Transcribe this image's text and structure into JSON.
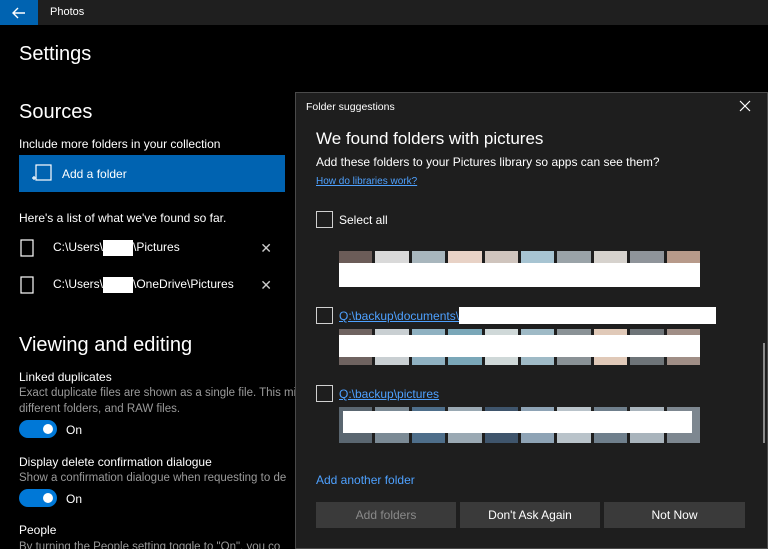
{
  "titlebar": {
    "app_title": "Photos"
  },
  "page_title": "Settings",
  "sources": {
    "heading": "Sources",
    "include_label": "Include more folders in your collection",
    "add_folder_label": "Add a folder",
    "list_label": "Here's a list of what we've found so far.",
    "folders": [
      {
        "prefix": "C:\\Users\\",
        "suffix": "\\Pictures"
      },
      {
        "prefix": "C:\\Users\\",
        "suffix": "\\OneDrive\\Pictures"
      }
    ]
  },
  "viewing": {
    "heading": "Viewing and editing",
    "linked_label": "Linked duplicates",
    "linked_desc_1": "Exact duplicate files are shown as a single file. This mi",
    "linked_desc_2": "different folders, and RAW files.",
    "linked_toggle": "On",
    "delete_label": "Display delete confirmation dialogue",
    "delete_desc": "Show a confirmation dialogue when requesting to de",
    "delete_toggle": "On",
    "people_label": "People",
    "people_desc": "By turning the People setting toggle to \"On\", you co"
  },
  "dialog": {
    "title": "Folder suggestions",
    "heading": "We found folders with pictures",
    "subtitle": "Add these folders to your Pictures library so apps can see them?",
    "help_link": "How do libraries work?",
    "select_all": "Select all",
    "folder_1": "Q:\\backup\\documents\\",
    "folder_2": "Q:\\backup\\pictures",
    "add_another": "Add another folder",
    "btn_add": "Add folders",
    "btn_dont_ask": "Don't Ask Again",
    "btn_not_now": "Not Now"
  },
  "colors": {
    "accent": "#0063b1",
    "link": "#4ea1ff",
    "toggle_on": "#0078d7"
  },
  "thumb_rows": [
    [
      "#6b5c58",
      "#d9d9d9",
      "#a8b6bd",
      "#e8d2c6",
      "#cfc4bd",
      "#a7c4d2",
      "#9aa3a8",
      "#d6d2cd",
      "#8f949a",
      "#b79a8a"
    ],
    [
      "#6f6360",
      "#c9cfd2",
      "#8fb1c1",
      "#7aa7b8",
      "#cfd8d8",
      "#9fbac6",
      "#8a9296",
      "#e0c9b8",
      "#6e7478",
      "#a08e86"
    ],
    [
      "#5a6670",
      "#7b8a95",
      "#4e6e8a",
      "#9aa9b3",
      "#3f556c",
      "#8ea3b5",
      "#b9c3ca",
      "#6f7f8c",
      "#a9b4bc",
      "#7d8790"
    ]
  ]
}
